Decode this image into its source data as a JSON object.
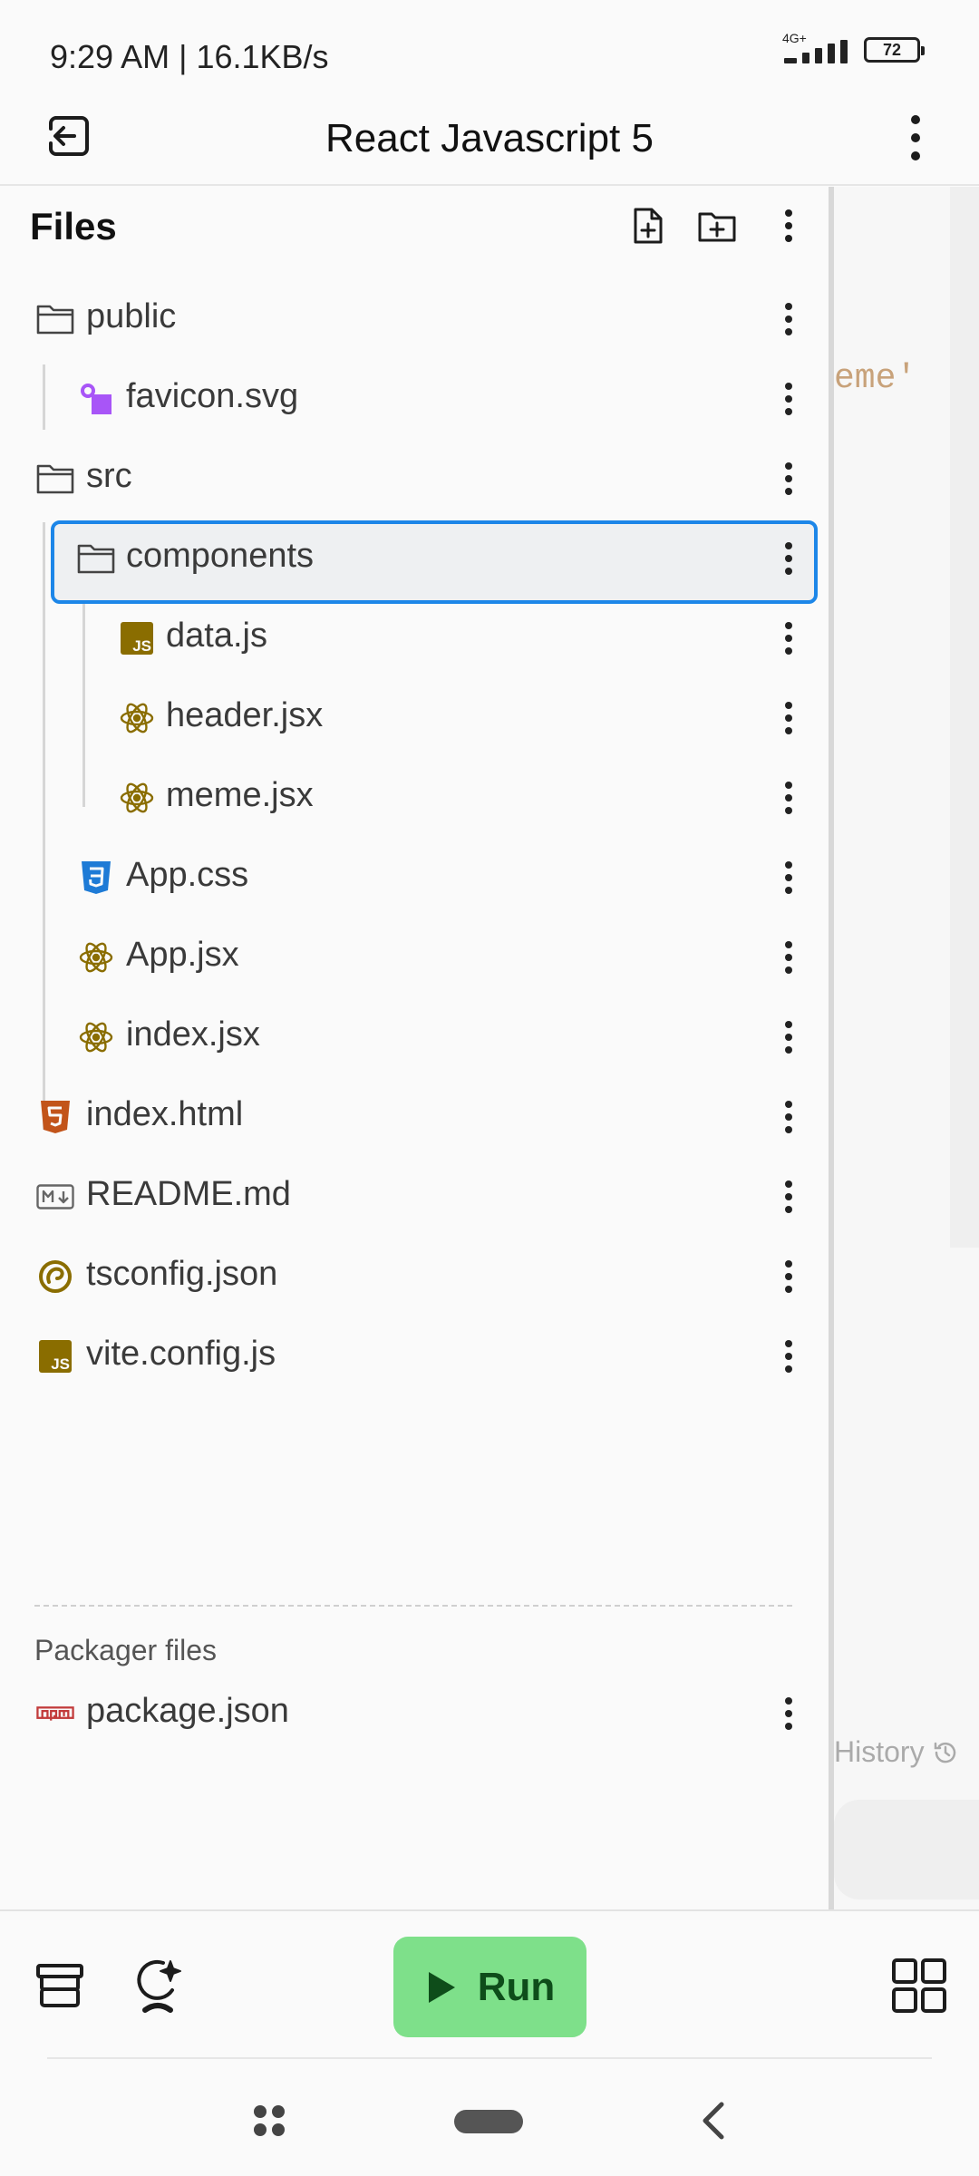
{
  "status_bar": {
    "time": "9:29 AM | 16.1KB/s",
    "network": "4G+",
    "battery": "72"
  },
  "app_bar": {
    "title": "React Javascript 5",
    "back_icon": "exit-icon",
    "menu_icon": "more-vertical-icon"
  },
  "files_panel": {
    "title": "Files",
    "new_file_icon": "file-plus-icon",
    "new_folder_icon": "folder-plus-icon",
    "more_icon": "more-vertical-icon",
    "items": [
      {
        "name": "public",
        "icon": "folder-icon",
        "depth": 0
      },
      {
        "name": "favicon.svg",
        "icon": "svg-file-icon",
        "depth": 1
      },
      {
        "name": "src",
        "icon": "folder-icon",
        "depth": 0
      },
      {
        "name": "components",
        "icon": "folder-icon",
        "depth": 1,
        "selected": true
      },
      {
        "name": "data.js",
        "icon": "javascript-icon",
        "depth": 2
      },
      {
        "name": "header.jsx",
        "icon": "react-icon",
        "depth": 2
      },
      {
        "name": "meme.jsx",
        "icon": "react-icon",
        "depth": 2
      },
      {
        "name": "App.css",
        "icon": "css-icon",
        "depth": 1
      },
      {
        "name": "App.jsx",
        "icon": "react-icon",
        "depth": 1
      },
      {
        "name": "index.jsx",
        "icon": "react-icon",
        "depth": 1
      },
      {
        "name": "index.html",
        "icon": "html-icon",
        "depth": 0
      },
      {
        "name": "README.md",
        "icon": "markdown-icon",
        "depth": 0
      },
      {
        "name": "tsconfig.json",
        "icon": "tsconfig-icon",
        "depth": 0
      },
      {
        "name": "vite.config.js",
        "icon": "javascript-icon",
        "depth": 0
      }
    ],
    "packager_label": "Packager files",
    "packager_items": [
      {
        "name": "package.json",
        "icon": "npm-icon",
        "depth": 0
      }
    ]
  },
  "editor": {
    "code_fragment": "eme'",
    "history_label": "History"
  },
  "toolbar": {
    "run_label": "Run",
    "colors": {
      "run_bg": "#7ee08a",
      "run_text": "#0e4d1a",
      "selection": "#1c86e8"
    }
  }
}
